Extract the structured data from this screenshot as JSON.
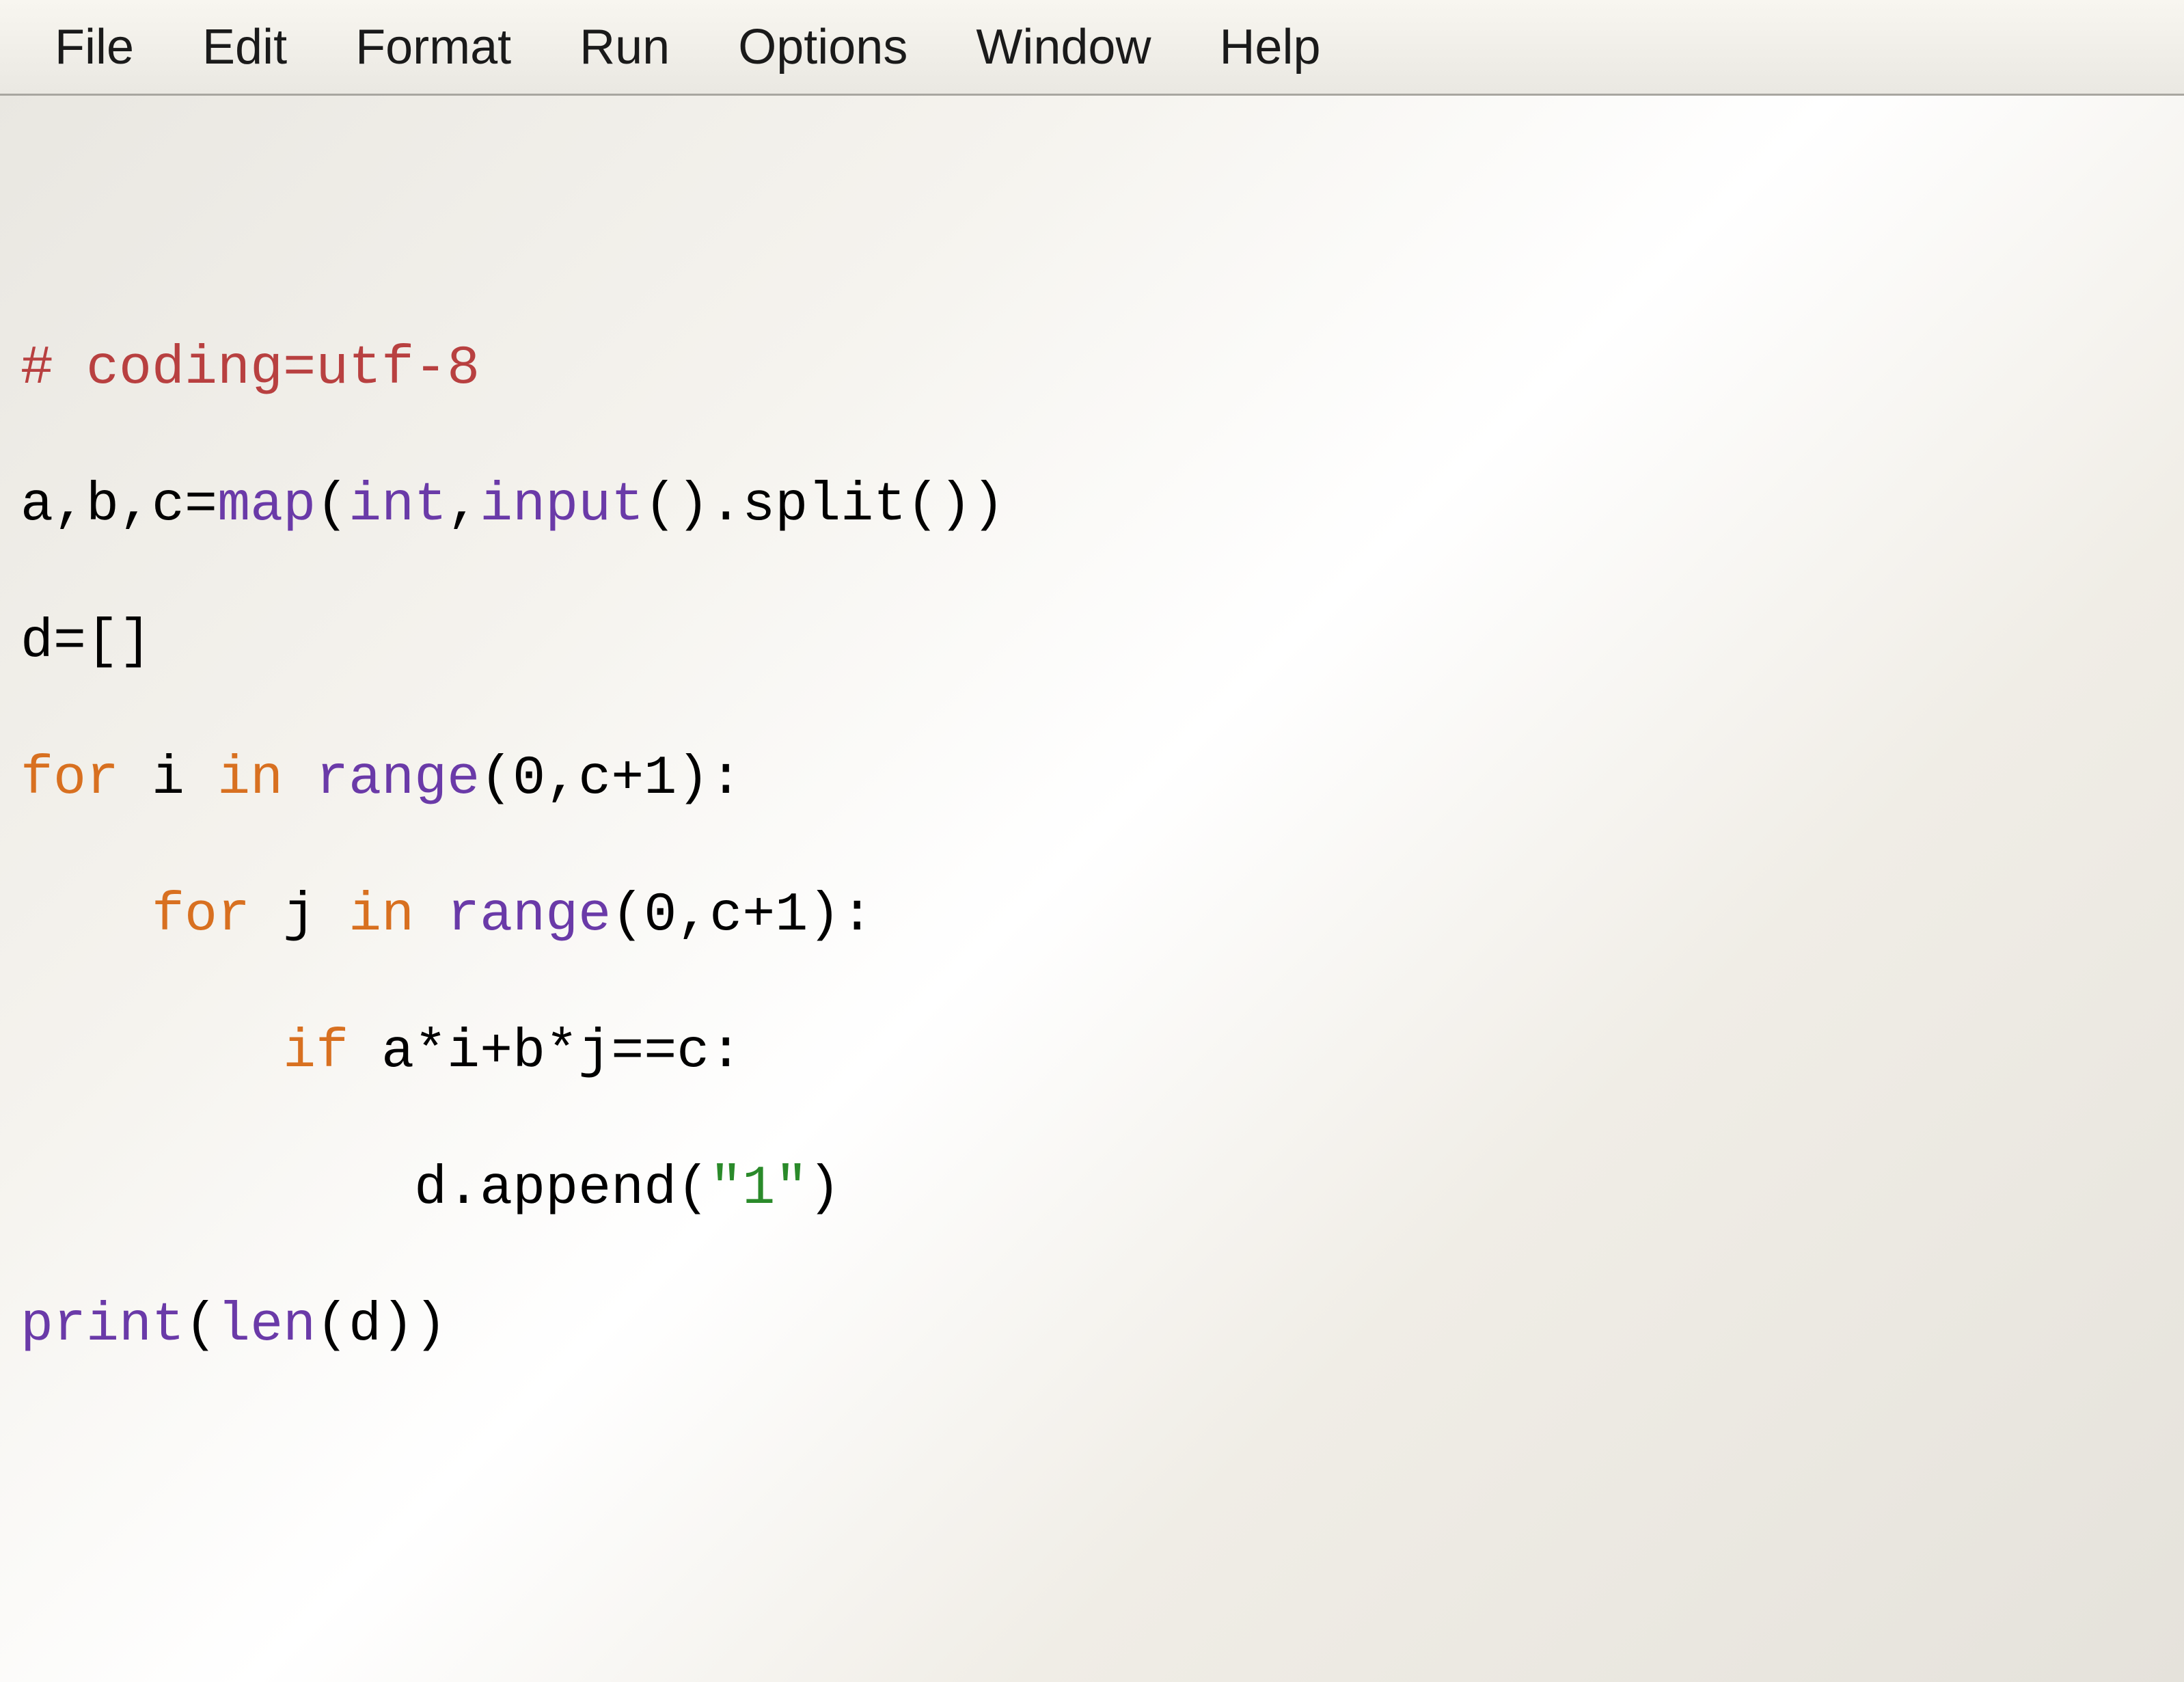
{
  "menubar": {
    "items": [
      {
        "label": "File"
      },
      {
        "label": "Edit"
      },
      {
        "label": "Format"
      },
      {
        "label": "Run"
      },
      {
        "label": "Options"
      },
      {
        "label": "Window"
      },
      {
        "label": "Help"
      }
    ]
  },
  "code": {
    "line1_comment": "# coding=utf-8",
    "line2": {
      "names": "a,b,c",
      "eq": "=",
      "map": "map",
      "open1": "(",
      "int": "int",
      "comma": ",",
      "input": "input",
      "parens1": "().",
      "split": "split",
      "parens2": "())"
    },
    "line3": {
      "name": "d",
      "eq": "=",
      "brackets": "[]"
    },
    "line4": {
      "for": "for",
      "sp1": " ",
      "i": "i",
      "sp2": " ",
      "in": "in",
      "sp3": " ",
      "range": "range",
      "args": "(",
      "zero": "0",
      "comma": ",",
      "cplus": "c",
      "plus": "+",
      "one": "1",
      "close": "):"
    },
    "line5": {
      "for": "for",
      "sp1": " ",
      "j": "j",
      "sp2": " ",
      "in": "in",
      "sp3": " ",
      "range": "range",
      "open": "(",
      "zero": "0",
      "comma": ",",
      "c": "c",
      "plus": "+",
      "one": "1",
      "close": "):"
    },
    "line6": {
      "if": "if",
      "sp": " ",
      "expr_a": "a",
      "star1": "*",
      "i": "i",
      "plus": "+",
      "b": "b",
      "star2": "*",
      "j": "j",
      "eqeq": "==",
      "c": "c",
      "colon": ":"
    },
    "line7": {
      "d": "d",
      "dot": ".",
      "append": "append",
      "open": "(",
      "str": "\"1\"",
      "close": ")"
    },
    "line8": {
      "print": "print",
      "open": "(",
      "len": "len",
      "open2": "(",
      "d": "d",
      "close": "))"
    }
  }
}
